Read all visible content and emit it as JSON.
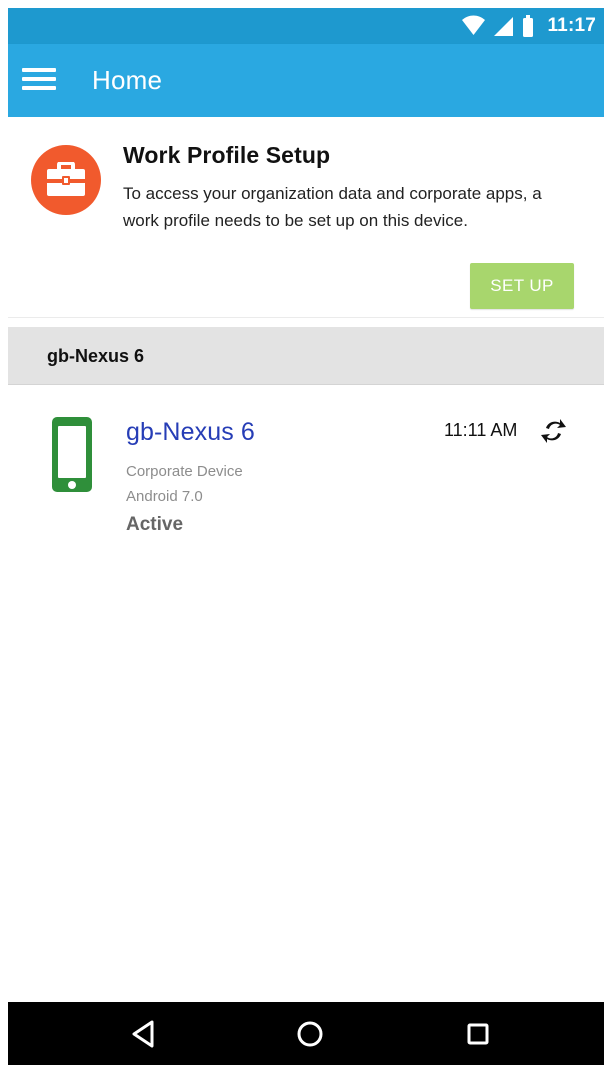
{
  "status_bar": {
    "time": "11:17",
    "icons": [
      "wifi-icon",
      "cellular-signal-icon",
      "battery-icon"
    ]
  },
  "app_bar": {
    "title": "Home",
    "menu_icon": "menu-icon"
  },
  "work_profile": {
    "icon": "briefcase-icon",
    "title": "Work Profile Setup",
    "description": "To access your organization data and corporate apps, a work profile needs to be set up on this device.",
    "button_label": "SET UP"
  },
  "device_section": {
    "header": "gb-Nexus 6"
  },
  "device": {
    "icon": "smartphone-icon",
    "name": "gb-Nexus 6",
    "type": "Corporate Device",
    "os": "Android 7.0",
    "status": "Active",
    "last_sync_time": "11:11 AM",
    "sync_icon": "refresh-icon"
  },
  "navigation": {
    "icons": [
      "back-icon",
      "home-icon",
      "recent-apps-icon"
    ]
  },
  "colors": {
    "status_bar": "#1e99cf",
    "app_bar": "#2aa8e1",
    "work_profile_icon": "#f15a2d",
    "setup_button": "#a8d66d",
    "device_name": "#263db6",
    "device_icon": "#2f8f3a",
    "section_header": "#e3e3e3"
  }
}
